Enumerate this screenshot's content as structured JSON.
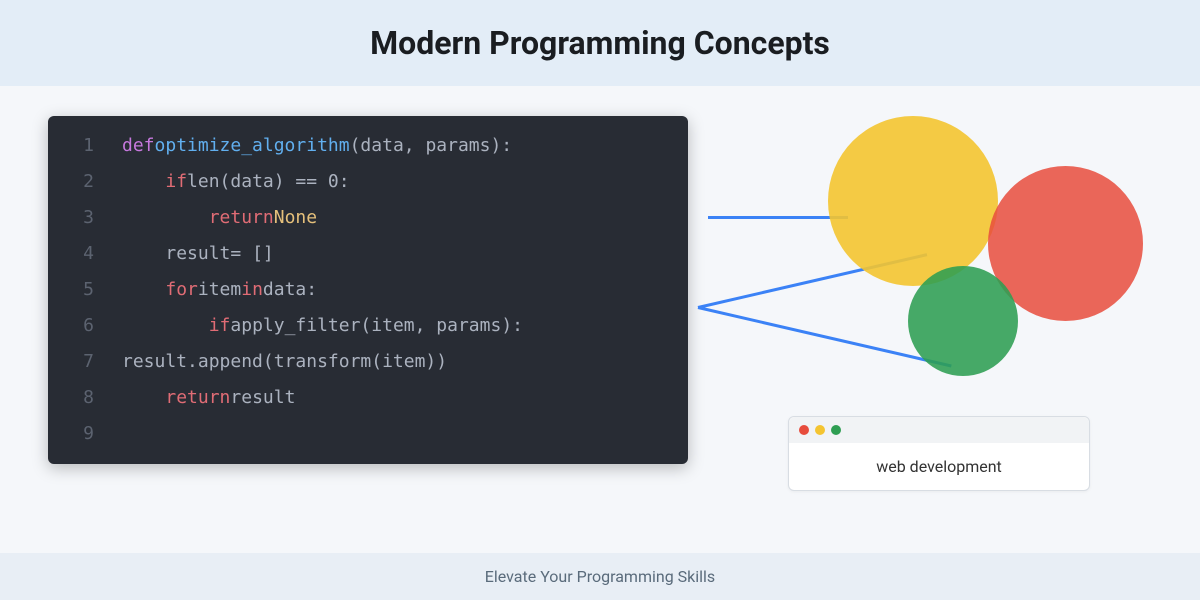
{
  "header": {
    "title": "Modern Programming Concepts"
  },
  "code": {
    "lines": [
      {
        "num": "1",
        "indent": 0,
        "tokens": [
          {
            "t": "def",
            "c": "kw"
          },
          {
            "t": "optimize_algorithm",
            "c": "fn"
          },
          {
            "t": "(data, params):",
            "c": "var"
          }
        ]
      },
      {
        "num": "2",
        "indent": 1,
        "tokens": [
          {
            "t": "if",
            "c": "cond"
          },
          {
            "t": "len(data) == 0:",
            "c": "var"
          }
        ]
      },
      {
        "num": "3",
        "indent": 2,
        "tokens": [
          {
            "t": "return",
            "c": "cond"
          },
          {
            "t": "None",
            "c": "lit"
          }
        ]
      },
      {
        "num": "4",
        "indent": 1,
        "tokens": [
          {
            "t": "result",
            "c": "var"
          },
          {
            "t": "= []",
            "c": "var"
          }
        ]
      },
      {
        "num": "5",
        "indent": 1,
        "tokens": [
          {
            "t": "for",
            "c": "cond"
          },
          {
            "t": "item",
            "c": "var"
          },
          {
            "t": "in",
            "c": "cond"
          },
          {
            "t": "data:",
            "c": "var"
          }
        ]
      },
      {
        "num": "6",
        "indent": 2,
        "tokens": [
          {
            "t": "if",
            "c": "cond"
          },
          {
            "t": "apply_filter(item, params):",
            "c": "var"
          }
        ]
      },
      {
        "num": "7",
        "indent": 0,
        "tokens": [
          {
            "t": "result.append(transform(item))",
            "c": "var"
          }
        ]
      },
      {
        "num": "8",
        "indent": 1,
        "tokens": [
          {
            "t": "return",
            "c": "cond"
          },
          {
            "t": "result",
            "c": "var"
          }
        ]
      },
      {
        "num": "9",
        "indent": 0,
        "tokens": []
      }
    ]
  },
  "diagram": {
    "circles": {
      "yellow": "#f4c430",
      "red": "#e74c3c",
      "green": "#2e9e52"
    }
  },
  "browser_card": {
    "label": "web development"
  },
  "footer": {
    "text": "Elevate Your Programming Skills"
  }
}
